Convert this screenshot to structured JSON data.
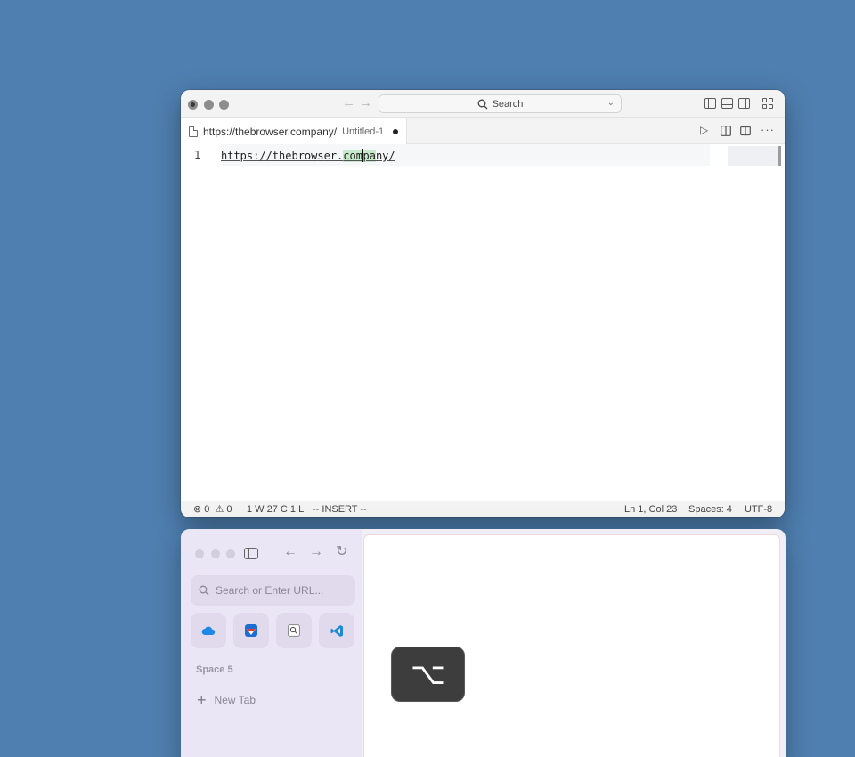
{
  "editor": {
    "search_label": "Search",
    "tab": {
      "title": "https://thebrowser.company/",
      "subtitle": "Untitled-1"
    },
    "code": {
      "line_number": "1",
      "before_selection": "https://thebrow",
      "cursor_char": "s",
      "mid": "er.",
      "selected_before_cursor": "com",
      "selected_after_cursor": "pa",
      "after_selection": "ny/"
    },
    "status": {
      "errors": "0",
      "warnings": "0",
      "word_count": "1 W 27 C 1 L",
      "mode": "-- INSERT --",
      "position": "Ln 1, Col 23",
      "spaces": "Spaces: 4",
      "encoding": "UTF-8"
    }
  },
  "browser": {
    "search_placeholder": "Search or Enter URL...",
    "space_label": "Space 5",
    "new_tab_label": "New Tab",
    "favorites": [
      "cloud-app",
      "arc-app",
      "search-app",
      "vscode-app"
    ]
  },
  "key_overlay": {
    "symbol": "⌥"
  },
  "colors": {
    "desktop": "#4f7fb0",
    "selection": "#c6e9c9",
    "tab_accent": "#f1a59a",
    "arc_sidebar": "#ebe6f5"
  }
}
